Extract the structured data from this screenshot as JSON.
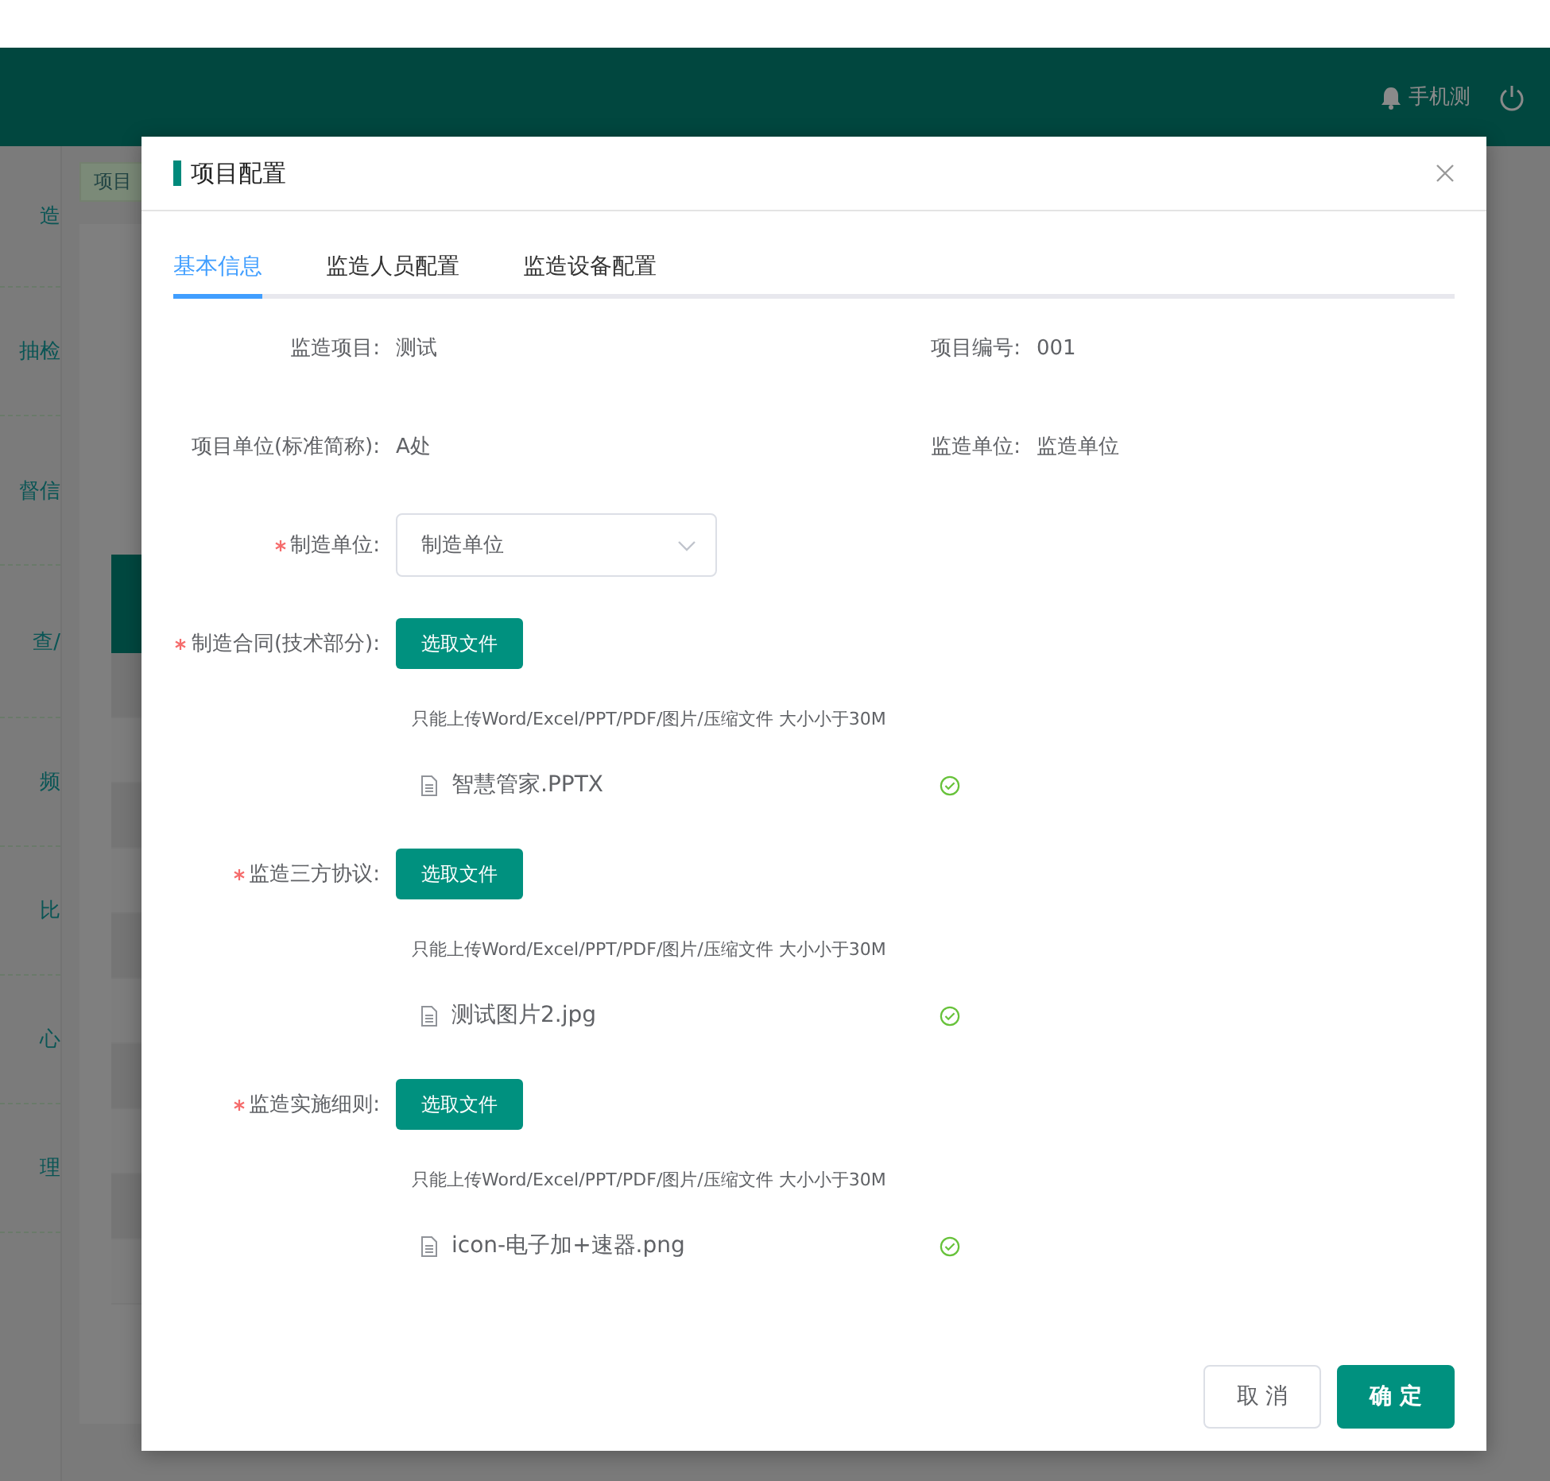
{
  "header": {
    "user": "手机测"
  },
  "sidebar": {
    "items": [
      {
        "label": "造"
      },
      {
        "label": "抽检"
      },
      {
        "label": "督信"
      },
      {
        "label": "查/"
      },
      {
        "label": "频"
      },
      {
        "label": "比"
      },
      {
        "label": "心"
      },
      {
        "label": "理"
      }
    ]
  },
  "breadcrumb": "项目",
  "dialog": {
    "title": "项目配置",
    "tabs": [
      {
        "label": "基本信息",
        "selected": true
      },
      {
        "label": "监造人员配置",
        "selected": false
      },
      {
        "label": "监造设备配置",
        "selected": false
      }
    ],
    "info": [
      [
        {
          "label": "监造项目:",
          "value": "测试"
        },
        {
          "label": "项目编号:",
          "value": "001"
        }
      ],
      [
        {
          "label": "项目单位(标准简称):",
          "value": "A处"
        },
        {
          "label": "监造单位:",
          "value": "监造单位"
        }
      ]
    ],
    "select": {
      "label": "制造单位:",
      "required": true,
      "value": "制造单位"
    },
    "uploads": [
      {
        "label": "制造合同(技术部分):",
        "required": true,
        "button": "选取文件",
        "tip": "只能上传Word/Excel/PPT/PDF/图片/压缩文件 大小小于30M",
        "file": {
          "name": "智慧管家.PPTX",
          "done": true
        }
      },
      {
        "label": "监造三方协议:",
        "required": true,
        "button": "选取文件",
        "tip": "只能上传Word/Excel/PPT/PDF/图片/压缩文件 大小小于30M",
        "file": {
          "name": "测试图片2.jpg",
          "done": true
        }
      },
      {
        "label": "监造实施细则:",
        "required": true,
        "button": "选取文件",
        "tip": "只能上传Word/Excel/PPT/PDF/图片/压缩文件 大小小于30M",
        "file": {
          "name": "icon-电子加+速器.png",
          "done": true
        }
      }
    ],
    "buttons": [
      {
        "label": "取 消",
        "kind": "default"
      },
      {
        "label": "确 定",
        "kind": "primary"
      }
    ]
  }
}
